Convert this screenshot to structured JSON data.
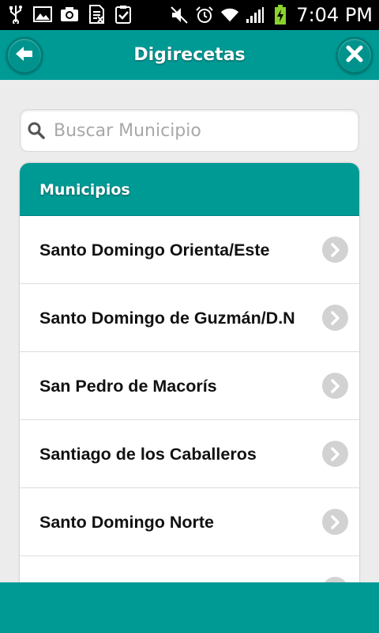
{
  "status_bar": {
    "time": "7:04 PM",
    "left_icons": [
      "usb-icon",
      "image-icon",
      "camera-icon",
      "sim-icon",
      "clipboard-check-icon"
    ],
    "right_icons": [
      "mute-icon",
      "alarm-icon",
      "wifi-icon",
      "signal-icon",
      "battery-charging-icon"
    ]
  },
  "header": {
    "title": "Digirecetas",
    "back_icon": "arrow-left-icon",
    "close_icon": "close-icon"
  },
  "search": {
    "placeholder": "Buscar Municipio",
    "value": "",
    "icon": "search-icon"
  },
  "list": {
    "header": "Municipios",
    "items": [
      {
        "label": "Santo Domingo Orienta/Este"
      },
      {
        "label": "Santo Domingo de Guzmán/D.N"
      },
      {
        "label": "San Pedro de Macorís"
      },
      {
        "label": "Santiago de los Caballeros"
      },
      {
        "label": "Santo Domingo Norte"
      },
      {
        "label": ""
      }
    ]
  },
  "colors": {
    "accent": "#009a95",
    "background": "#ececec",
    "status_bar": "#000000"
  }
}
